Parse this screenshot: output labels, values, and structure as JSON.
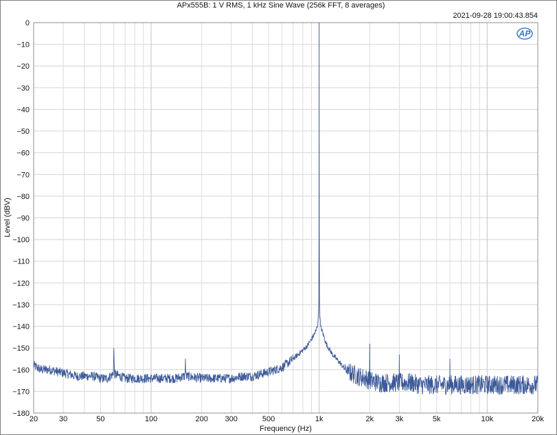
{
  "chart_data": {
    "type": "line",
    "title": "APx555B: 1 V RMS, 1 kHz Sine Wave (256k FFT, 8 averages)",
    "timestamp": "2021-09-28 19:00:43.854",
    "logo_text": "AP",
    "xlabel": "Frequency (Hz)",
    "ylabel": "Level (dBV)",
    "x_scale": "log",
    "xlim": [
      20,
      20000
    ],
    "ylim": [
      -180,
      0
    ],
    "grid": true,
    "x_ticks": [
      {
        "value": 20,
        "label": "20"
      },
      {
        "value": 30,
        "label": "30"
      },
      {
        "value": 50,
        "label": "50"
      },
      {
        "value": 100,
        "label": "100"
      },
      {
        "value": 200,
        "label": "200"
      },
      {
        "value": 300,
        "label": "300"
      },
      {
        "value": 500,
        "label": "500"
      },
      {
        "value": 1000,
        "label": "1k"
      },
      {
        "value": 2000,
        "label": "2k"
      },
      {
        "value": 3000,
        "label": "3k"
      },
      {
        "value": 5000,
        "label": "5k"
      },
      {
        "value": 10000,
        "label": "10k"
      },
      {
        "value": 20000,
        "label": "20k"
      }
    ],
    "y_ticks": [
      0,
      -10,
      -20,
      -30,
      -40,
      -50,
      -60,
      -70,
      -80,
      -90,
      -100,
      -110,
      -120,
      -130,
      -140,
      -150,
      -160,
      -170,
      -180
    ],
    "series": [
      {
        "color": "#3d5a99",
        "points": [
          [
            20,
            -158
          ],
          [
            22,
            -160
          ],
          [
            25,
            -160
          ],
          [
            28,
            -161
          ],
          [
            32,
            -162
          ],
          [
            36,
            -163
          ],
          [
            40,
            -163
          ],
          [
            45,
            -163
          ],
          [
            50,
            -164
          ],
          [
            55,
            -164
          ],
          [
            59.5,
            -162
          ],
          [
            60,
            -150
          ],
          [
            60.5,
            -162
          ],
          [
            70,
            -164
          ],
          [
            80,
            -164
          ],
          [
            100,
            -164
          ],
          [
            120,
            -164
          ],
          [
            140,
            -164
          ],
          [
            159,
            -163
          ],
          [
            160,
            -155
          ],
          [
            161,
            -163
          ],
          [
            200,
            -164
          ],
          [
            250,
            -164
          ],
          [
            300,
            -164
          ],
          [
            350,
            -163
          ],
          [
            400,
            -163
          ],
          [
            450,
            -162
          ],
          [
            500,
            -161
          ],
          [
            550,
            -160
          ],
          [
            600,
            -159
          ],
          [
            650,
            -157
          ],
          [
            700,
            -155
          ],
          [
            750,
            -153
          ],
          [
            800,
            -151
          ],
          [
            850,
            -149
          ],
          [
            900,
            -146
          ],
          [
            930,
            -144
          ],
          [
            960,
            -142
          ],
          [
            980,
            -139
          ],
          [
            990,
            -135
          ],
          [
            995,
            -125
          ],
          [
            998,
            -100
          ],
          [
            999.5,
            -50
          ],
          [
            1000,
            0
          ],
          [
            1000.5,
            -50
          ],
          [
            1002,
            -100
          ],
          [
            1005,
            -125
          ],
          [
            1010,
            -135
          ],
          [
            1020,
            -140
          ],
          [
            1050,
            -143
          ],
          [
            1100,
            -148
          ],
          [
            1200,
            -153
          ],
          [
            1300,
            -156
          ],
          [
            1400,
            -159
          ],
          [
            1500,
            -161
          ],
          [
            1700,
            -163
          ],
          [
            1900,
            -164
          ],
          [
            1995,
            -165
          ],
          [
            2000,
            -148
          ],
          [
            2005,
            -165
          ],
          [
            2300,
            -166
          ],
          [
            2700,
            -166
          ],
          [
            2995,
            -166
          ],
          [
            3000,
            -153
          ],
          [
            3005,
            -166
          ],
          [
            3500,
            -166
          ],
          [
            4000,
            -167
          ],
          [
            5000,
            -167
          ],
          [
            5990,
            -167
          ],
          [
            6000,
            -155
          ],
          [
            6010,
            -167
          ],
          [
            7000,
            -167
          ],
          [
            8000,
            -167
          ],
          [
            10000,
            -167
          ],
          [
            12000,
            -167
          ],
          [
            15000,
            -167
          ],
          [
            18000,
            -167
          ],
          [
            20000,
            -167
          ]
        ]
      }
    ]
  }
}
